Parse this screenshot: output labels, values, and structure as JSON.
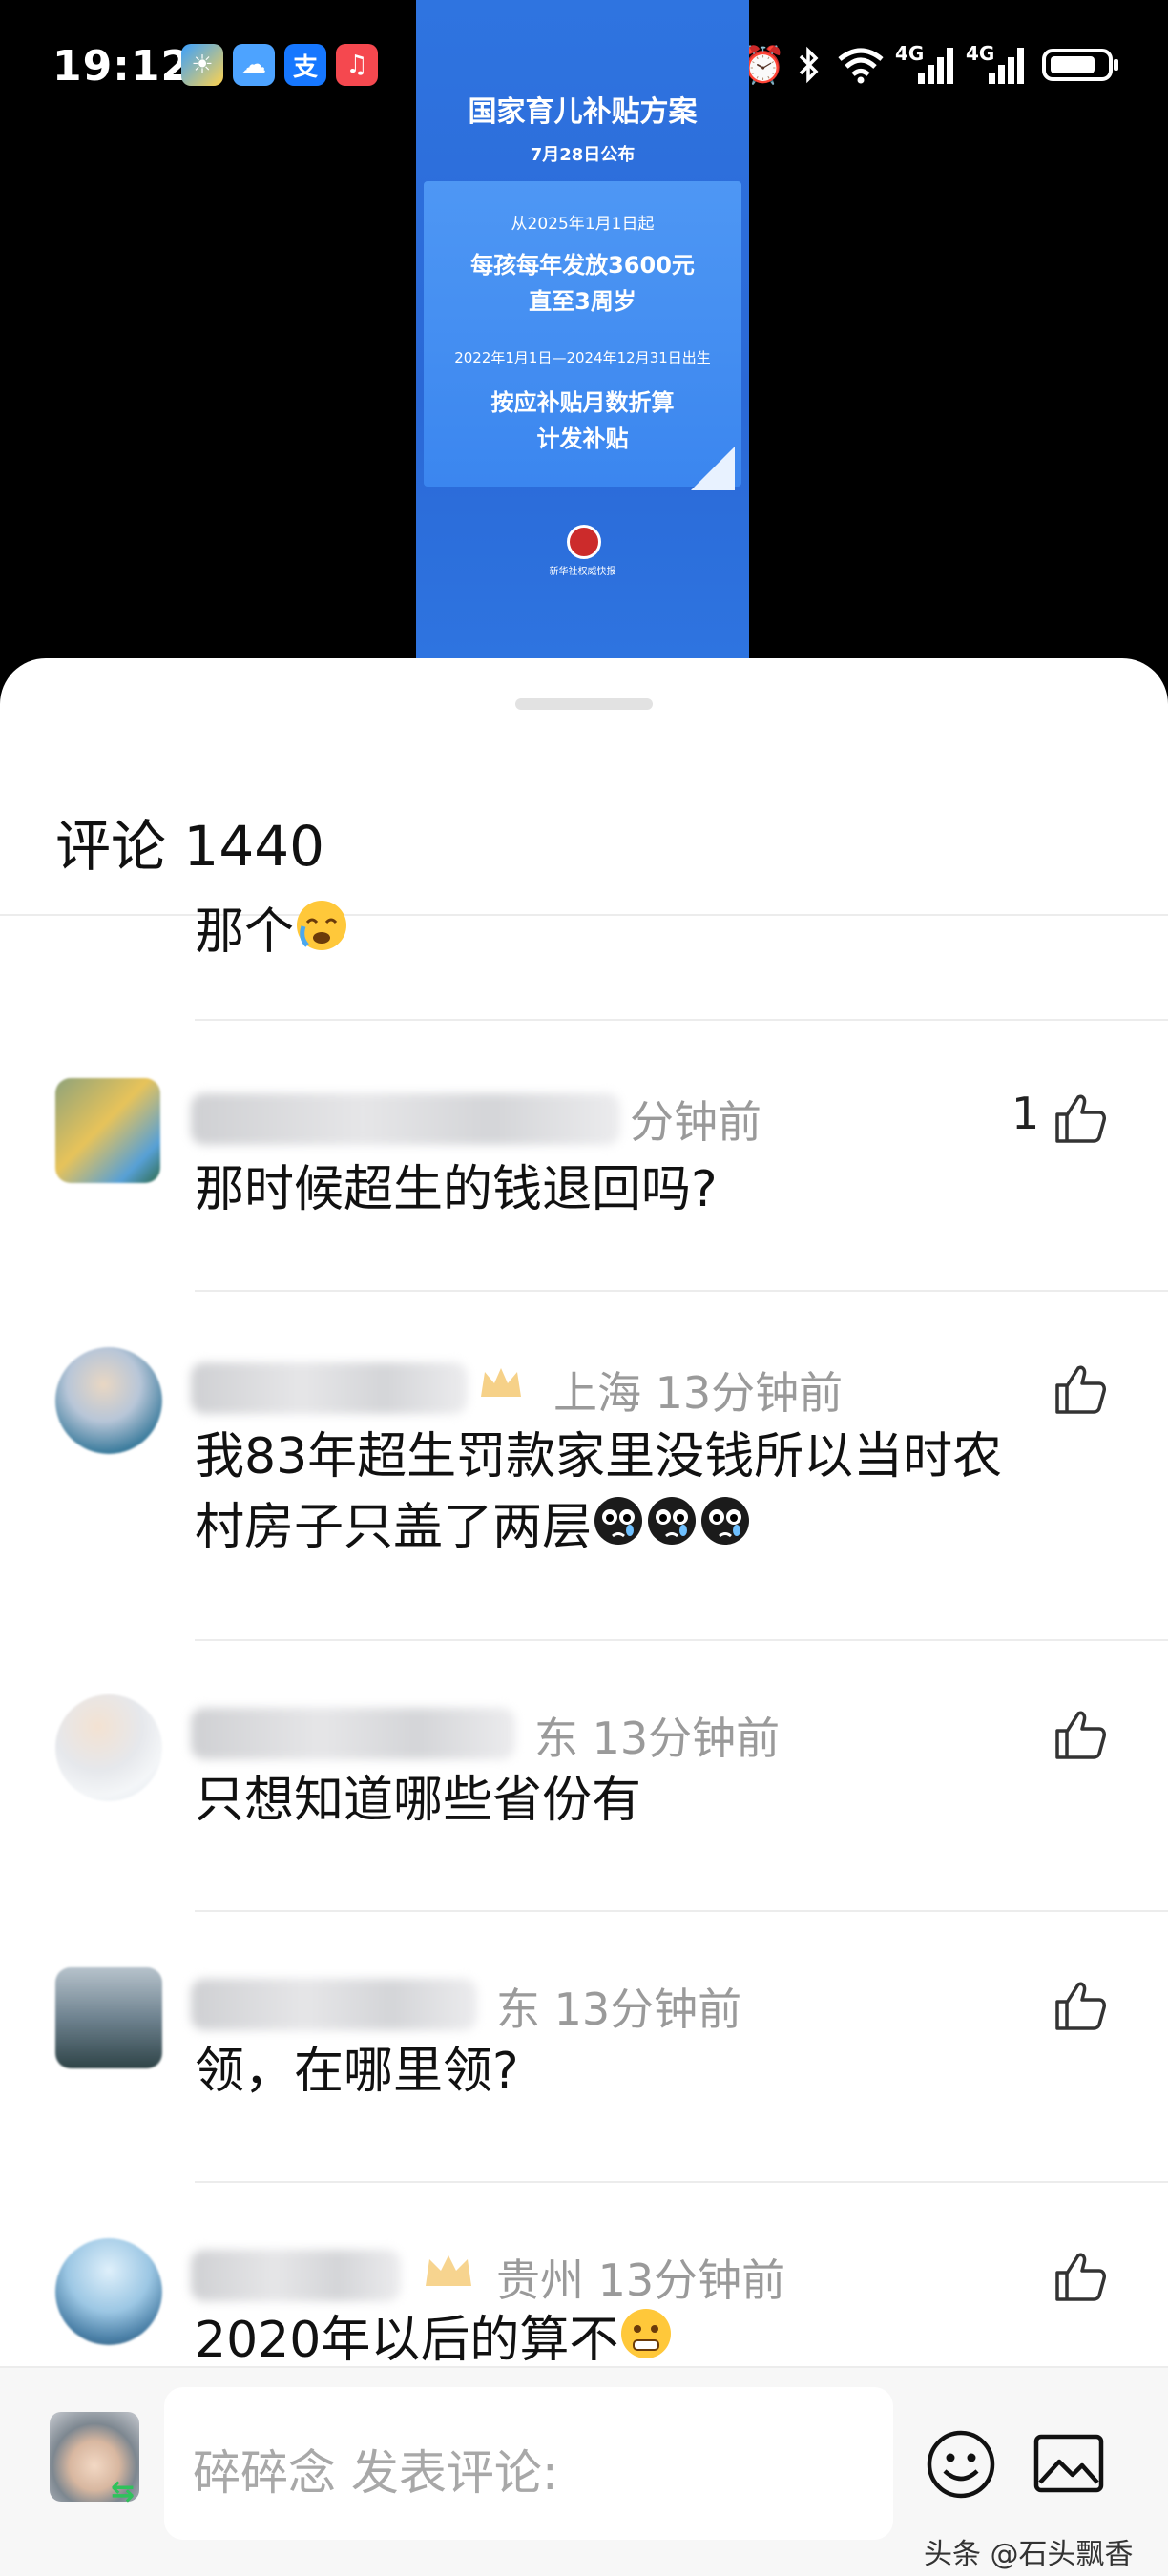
{
  "status_bar": {
    "time": "19:12",
    "apps": [
      "weather-app-icon",
      "cloud-app-icon",
      "alipay-icon",
      "music-app-icon"
    ],
    "alipay_label": "支",
    "network_1": "4G",
    "network_2": "4G"
  },
  "poster": {
    "title": "国家育儿补贴方案",
    "date": "7月28日公布",
    "line1": "从2025年1月1日起",
    "line2": "每孩每年发放3600元",
    "line3": "直至3周岁",
    "line4": "2022年1月1日—2024年12月31日出生",
    "line5": "按应补贴月数折算",
    "line6": "计发补贴",
    "source": "新华社权威快报"
  },
  "sheet": {
    "title": "评论 1440"
  },
  "comments": [
    {
      "text": "那个",
      "meta": "",
      "likes": ""
    },
    {
      "text": "那时候超生的钱退回吗?",
      "meta": "分钟前",
      "likes": "1"
    },
    {
      "text_line1": "我83年超生罚款家里没钱所以当时农",
      "text_line2": "村房子只盖了两层",
      "meta": "上海 13分钟前",
      "likes": ""
    },
    {
      "text": "只想知道哪些省份有",
      "meta": "东 13分钟前",
      "likes": ""
    },
    {
      "text": "领，在哪里领?",
      "meta": "东 13分钟前",
      "likes": ""
    },
    {
      "text": "2020年以后的算不",
      "meta": "贵州 13分钟前",
      "likes": ""
    }
  ],
  "bottom_bar": {
    "placeholder": "碎碎念 发表评论:"
  },
  "watermark": "头条 @石头飘香"
}
